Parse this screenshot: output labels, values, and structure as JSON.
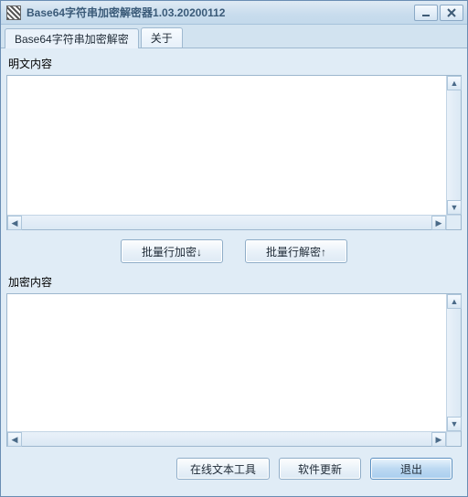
{
  "window": {
    "title": "Base64字符串加密解密器1.03.20200112"
  },
  "tabs": {
    "main": "Base64字符串加密解密",
    "about": "关于"
  },
  "labels": {
    "plaintext": "明文内容",
    "ciphertext": "加密内容"
  },
  "buttons": {
    "batch_encrypt": "批量行加密↓",
    "batch_decrypt": "批量行解密↑",
    "online_tool": "在线文本工具",
    "update": "软件更新",
    "exit": "退出"
  },
  "fields": {
    "plaintext_value": "",
    "ciphertext_value": ""
  }
}
